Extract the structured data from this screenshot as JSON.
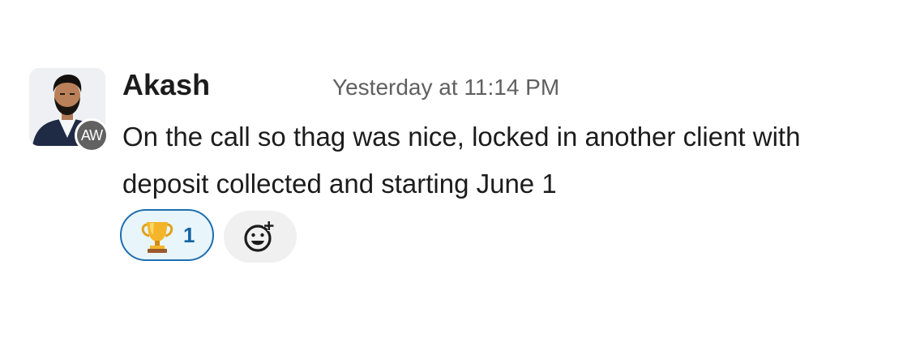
{
  "message": {
    "author": "Akash",
    "timestamp": "Yesterday at 11:14 PM",
    "text": "On the call so thag was nice, locked in another client with deposit collected and starting June 1",
    "avatar_badge": "AW",
    "reactions": [
      {
        "emoji": "trophy-icon",
        "count": "1",
        "reacted_by_me": true
      }
    ],
    "add_reaction_icon": "add-emoji-icon"
  },
  "colors": {
    "text": "#1d1c1d",
    "timestamp": "#616061",
    "reaction_border": "#1d6fb0",
    "reaction_bg": "#e8f5fa",
    "reaction_count": "#1264a3",
    "badge_bg": "#616161",
    "add_reaction_bg": "#f0f0f0"
  }
}
